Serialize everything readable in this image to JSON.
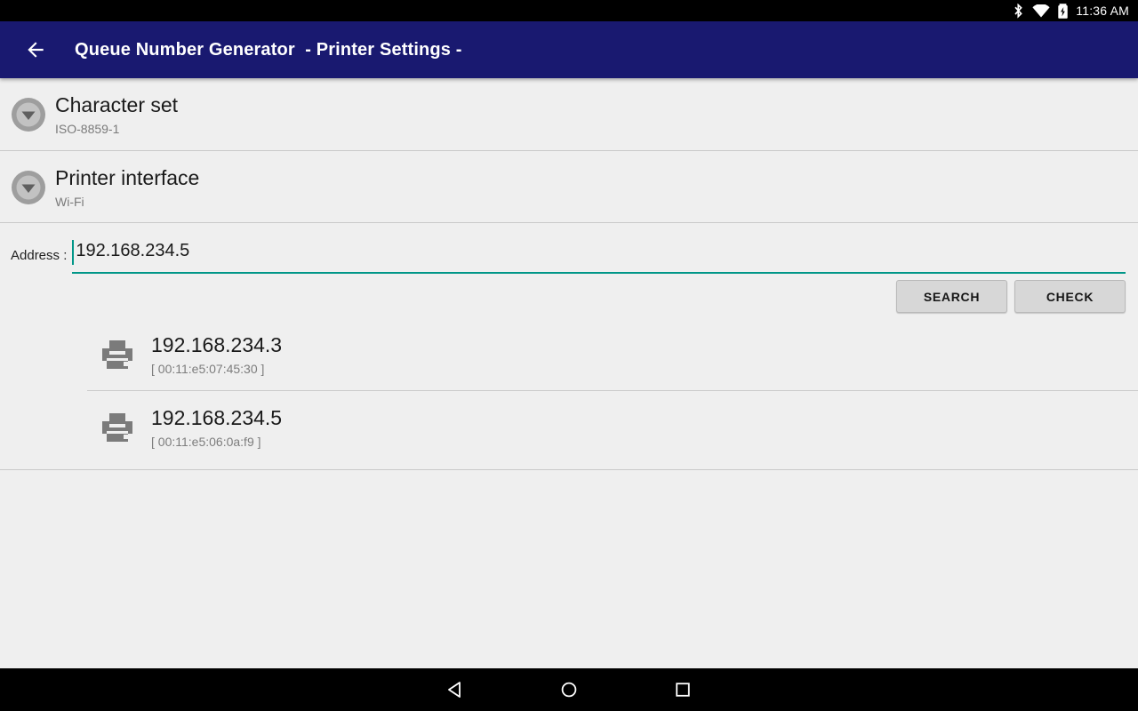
{
  "status_bar": {
    "bluetooth_icon": "bluetooth-icon",
    "wifi_icon": "wifi-icon",
    "battery_icon": "battery-charging-icon",
    "time": "11:36 AM"
  },
  "app_bar": {
    "back_icon": "back-arrow-icon",
    "title": "Queue Number Generator  - Printer Settings -",
    "background_color": "#191970",
    "title_color": "#ffffff"
  },
  "settings": [
    {
      "icon": "chevron-down-circle-icon",
      "title": "Character set",
      "value": "ISO-8859-1"
    },
    {
      "icon": "chevron-down-circle-icon",
      "title": "Printer interface",
      "value": "Wi-Fi"
    }
  ],
  "address": {
    "label": "Address :",
    "value": "192.168.234.5",
    "placeholder": "",
    "underline_color": "#009688",
    "caret_color": "#009688"
  },
  "buttons": {
    "search_label": "SEARCH",
    "check_label": "CHECK",
    "background_color": "#d7d7d7"
  },
  "printers": [
    {
      "icon": "printer-icon",
      "ip": "192.168.234.3",
      "mac": "[ 00:11:e5:07:45:30 ]"
    },
    {
      "icon": "printer-icon",
      "ip": "192.168.234.5",
      "mac": "[ 00:11:e5:06:0a:f9 ]"
    }
  ],
  "nav_bar": {
    "back_icon": "nav-back-triangle-icon",
    "home_icon": "nav-home-circle-icon",
    "recents_icon": "nav-recents-square-icon"
  },
  "colors": {
    "page_background": "#efefef",
    "divider": "#c9c9c9",
    "primary_text": "#1a1a1a",
    "secondary_text": "#7a7a7a"
  }
}
